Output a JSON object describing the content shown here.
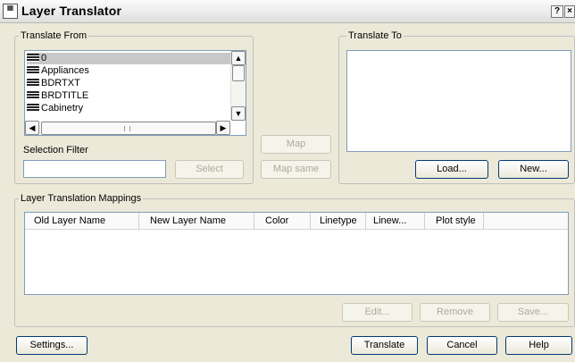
{
  "window": {
    "title": "Layer Translator",
    "help_glyph": "?",
    "close_glyph": "×"
  },
  "translate_from": {
    "legend": "Translate From",
    "layers": [
      {
        "name": "0",
        "selected": true
      },
      {
        "name": "Appliances",
        "selected": false
      },
      {
        "name": "BDRTXT",
        "selected": false
      },
      {
        "name": "BRDTITLE",
        "selected": false
      },
      {
        "name": "Cabinetry",
        "selected": false
      }
    ],
    "selection_filter_label": "Selection Filter",
    "selection_filter_value": "",
    "select_button": "Select"
  },
  "middle": {
    "map_button": "Map",
    "map_same_button": "Map same"
  },
  "translate_to": {
    "legend": "Translate To",
    "load_button": "Load...",
    "new_button": "New..."
  },
  "mappings": {
    "legend": "Layer Translation Mappings",
    "columns": [
      "Old Layer Name",
      "New Layer Name",
      "Color",
      "Linetype",
      "Linew...",
      "Plot style"
    ],
    "rows": [],
    "edit_button": "Edit...",
    "remove_button": "Remove",
    "save_button": "Save..."
  },
  "footer": {
    "settings_button": "Settings...",
    "translate_button": "Translate",
    "cancel_button": "Cancel",
    "help_button": "Help"
  },
  "icons": {
    "scroll_up": "up-arrow-icon",
    "scroll_down": "down-arrow-icon",
    "scroll_left": "left-arrow-icon",
    "scroll_right": "right-arrow-icon",
    "layer": "layer-stack-icon"
  }
}
